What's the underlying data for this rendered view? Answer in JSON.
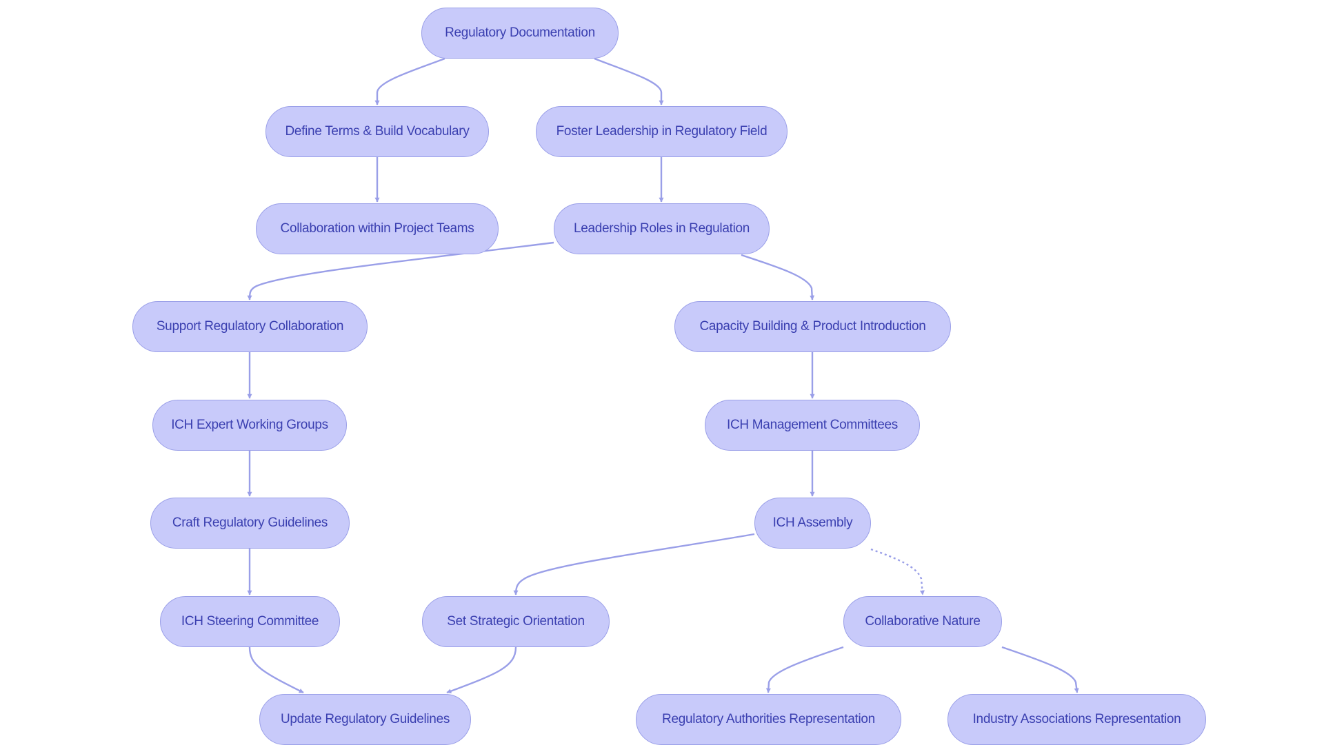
{
  "diagram": {
    "type": "flowchart",
    "colors": {
      "node_fill": "#c8cafa",
      "node_stroke": "#9a9fe8",
      "text": "#3a3fb0",
      "edge": "#9a9fe8"
    },
    "nodes": [
      {
        "id": "root",
        "label": "Regulatory Documentation"
      },
      {
        "id": "define",
        "label": "Define Terms & Build Vocabulary"
      },
      {
        "id": "foster",
        "label": "Foster Leadership in Regulatory Field"
      },
      {
        "id": "collab",
        "label": "Collaboration within Project Teams"
      },
      {
        "id": "leadership",
        "label": "Leadership Roles in Regulation"
      },
      {
        "id": "support",
        "label": "Support Regulatory Collaboration"
      },
      {
        "id": "capacity",
        "label": "Capacity Building & Product Introduction"
      },
      {
        "id": "ewg",
        "label": "ICH Expert Working Groups"
      },
      {
        "id": "mgmt",
        "label": "ICH Management Committees"
      },
      {
        "id": "craft",
        "label": "Craft Regulatory Guidelines"
      },
      {
        "id": "assembly",
        "label": "ICH Assembly"
      },
      {
        "id": "steering",
        "label": "ICH Steering Committee"
      },
      {
        "id": "strategic",
        "label": "Set Strategic Orientation"
      },
      {
        "id": "nature",
        "label": "Collaborative Nature"
      },
      {
        "id": "update",
        "label": "Update Regulatory Guidelines"
      },
      {
        "id": "authorities",
        "label": "Regulatory Authorities Representation"
      },
      {
        "id": "industry",
        "label": "Industry Associations Representation"
      }
    ],
    "edges": [
      {
        "from": "root",
        "to": "define",
        "style": "solid"
      },
      {
        "from": "root",
        "to": "foster",
        "style": "solid"
      },
      {
        "from": "define",
        "to": "collab",
        "style": "solid"
      },
      {
        "from": "foster",
        "to": "leadership",
        "style": "solid"
      },
      {
        "from": "leadership",
        "to": "support",
        "style": "solid"
      },
      {
        "from": "leadership",
        "to": "capacity",
        "style": "solid"
      },
      {
        "from": "support",
        "to": "ewg",
        "style": "solid"
      },
      {
        "from": "capacity",
        "to": "mgmt",
        "style": "solid"
      },
      {
        "from": "ewg",
        "to": "craft",
        "style": "solid"
      },
      {
        "from": "mgmt",
        "to": "assembly",
        "style": "solid"
      },
      {
        "from": "craft",
        "to": "steering",
        "style": "solid"
      },
      {
        "from": "assembly",
        "to": "strategic",
        "style": "solid"
      },
      {
        "from": "assembly",
        "to": "nature",
        "style": "dotted"
      },
      {
        "from": "steering",
        "to": "update",
        "style": "solid"
      },
      {
        "from": "strategic",
        "to": "update",
        "style": "solid"
      },
      {
        "from": "nature",
        "to": "authorities",
        "style": "solid"
      },
      {
        "from": "nature",
        "to": "industry",
        "style": "solid"
      }
    ]
  }
}
